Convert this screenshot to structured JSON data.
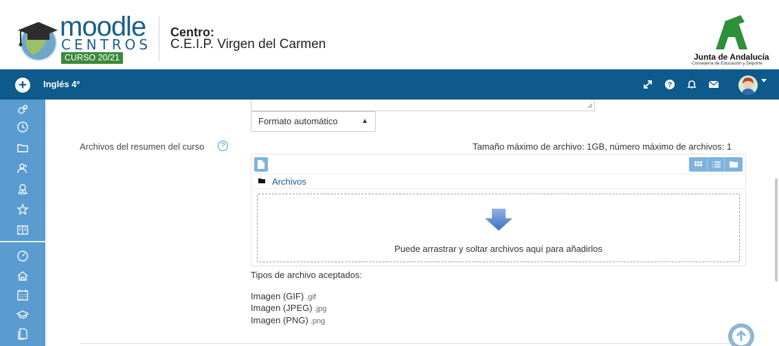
{
  "header": {
    "logo_moodle": "moodle",
    "logo_centros": "CENTROS",
    "logo_curso": "CURSO 20/21",
    "centro_label": "Centro:",
    "centro_name": "C.E.I.P. Virgen del Carmen",
    "junta_title": "Junta de Andalucía",
    "junta_subtitle": "Consejería de Educación y Deporte"
  },
  "navbar": {
    "course_name": "Inglés 4º",
    "color": "#0e5a8c",
    "icons": [
      "expand-icon",
      "help-icon",
      "bell-icon",
      "envelope-icon",
      "avatar",
      "caret-down-icon"
    ]
  },
  "sidebar": {
    "color": "#5a9bd0",
    "items": [
      "gears-icon",
      "clock-icon",
      "folder-icon",
      "users-icon",
      "badge-icon",
      "star-icon",
      "book-icon",
      "dashboard-icon",
      "home-icon",
      "calendar-icon",
      "graduation-cap-icon",
      "files-icon"
    ]
  },
  "form": {
    "format_select": "Formato automático",
    "files_label": "Archivos del resumen del curso",
    "max_size_text": "Tamaño máximo de archivo: 1GB, número máximo de archivos: 1",
    "path_folder": "Archivos",
    "drop_text": "Puede arrastrar y soltar archivos aquí para añadirlos",
    "accepted_title": "Tipos de archivo aceptados:",
    "file_types": [
      {
        "name": "Imagen (GIF)",
        "ext": ".gif"
      },
      {
        "name": "Imagen (JPEG)",
        "ext": ".jpg"
      },
      {
        "name": "Imagen (PNG)",
        "ext": ".png"
      }
    ]
  }
}
